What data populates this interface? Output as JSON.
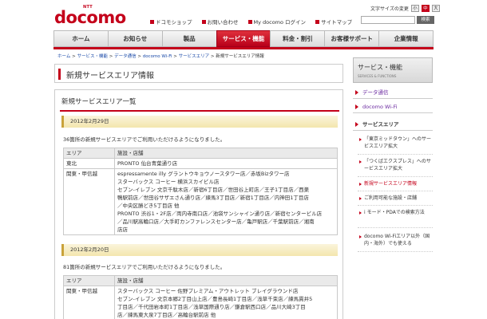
{
  "header": {
    "logo_top": "NTT",
    "logo": "docomo",
    "font_size_label": "文字サイズの変更",
    "font_sizes": [
      "小",
      "中",
      "大"
    ],
    "links": [
      "ドコモショップ",
      "お問い合わせ",
      "My docomo ログイン",
      "サイトマップ"
    ],
    "search_button": "検索"
  },
  "nav": {
    "items": [
      "ホーム",
      "お知らせ",
      "製品",
      "サービス・機能",
      "料金・割引",
      "お客様サポート",
      "企業情報"
    ],
    "active": "サービス・機能"
  },
  "breadcrumb": {
    "items": [
      "ホーム",
      "サービス・機能",
      "データ通信",
      "docomo Wi-Fi",
      "サービスエリア"
    ],
    "current": "新規サービスエリア情報",
    "separator": " > "
  },
  "page_title": "新規サービスエリア情報",
  "main": {
    "heading": "新規サービスエリア一覧",
    "sections": [
      {
        "date": "2012年2月29日",
        "note": "36箇所の新規サービスエリアでご利用いただけるようになりました。",
        "col_area": "エリア",
        "col_shop": "施設・店舗",
        "rows": [
          {
            "area": "東北",
            "lines": [
              "PRONTO 仙台青葉通り店"
            ]
          },
          {
            "area": "関東・甲信越",
            "lines": [
              "espressamente illy グラントウキョウノースタワー店／赤坂Bizタワー店",
              "スターバックス コーヒー 横浜スカイビル店",
              "セブン-イレブン 文京千駄木店／新宿6丁目店／世田谷上町店／王子1丁目店／西巣",
              "鴨駅前店／世田谷サザエさん通り店／練馬3丁目店／新宿1丁目店／内神田1丁目店",
              "／中央区勝どき5丁目店 他",
              "PRONTO 渋谷1・2F店／両内寺南口店／池袋サンシャイン通り店／新宿センタービル店",
              "／品川駅高輪口店／大手町カンファレンスセンター店／亀戸駅店／千葉駅前店／湘南",
              "店店"
            ]
          }
        ]
      },
      {
        "date": "2012年2月20日",
        "note": "81箇所の新規サービスエリアでご利用いただけるようになりました。",
        "col_area": "エリア",
        "col_shop": "施設・店舗",
        "rows": [
          {
            "area": "関東・甲信越",
            "lines": [
              "スターバックス コーヒー 佐野プレミアム・アウトレット ブレイグラウンド店",
              "セブン-イレブン 文京本郷2丁目山上店／豊島長崎1丁目店／浅草千束店／練馬貫井5",
              "丁目店／千代田岩本町1丁目店／浅草国際通り店／鎌倉駅西口店／品川大崎3丁目",
              "店／練馬東大泉7丁目店／高輪台駅前店 他"
            ]
          }
        ]
      }
    ]
  },
  "sidebar": {
    "title": "サービス・機能",
    "subtitle": "SERVICES & FUNCTIONS",
    "items": [
      "データ通信",
      "docomo Wi-Fi",
      "サービスエリア"
    ],
    "sub_items": [
      "「東京ミッドタウン」へのサービスエリア拡大",
      "「つくばエクスプレス」へのサービスエリア拡大",
      "新規サービスエリア情報",
      "ご利用可能な施設・店舗",
      "i モード・PDAでの検索方法",
      "docomo Wi-Fiエリア以外（国内・海外）でも使える"
    ],
    "current_sub": "新規サービスエリア情報"
  }
}
